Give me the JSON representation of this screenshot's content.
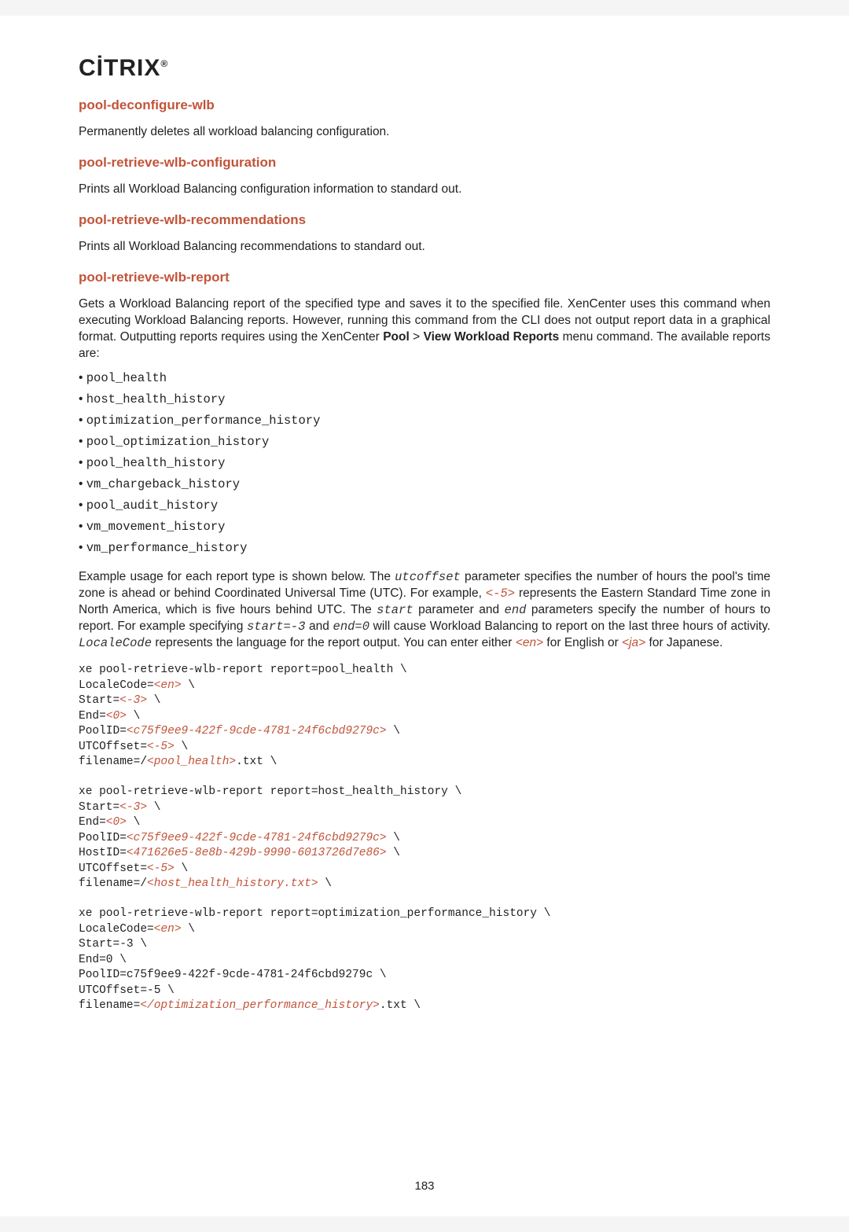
{
  "logo": "CİTRIX",
  "sections": {
    "s1": {
      "title": "pool-deconfigure-wlb",
      "text": "Permanently deletes all workload balancing configuration."
    },
    "s2": {
      "title": "pool-retrieve-wlb-configuration",
      "text": "Prints all Workload Balancing configuration information to standard out."
    },
    "s3": {
      "title": "pool-retrieve-wlb-recommendations",
      "text": "Prints all Workload Balancing recommendations to standard out."
    },
    "s4": {
      "title": "pool-retrieve-wlb-report"
    }
  },
  "s4_intro_1": "Gets a Workload Balancing report of the specified type and saves it to the specified file. XenCenter uses this command when executing Workload Balancing reports. However, running this command from the CLI does not output report data in a graphical format. Outputting reports requires using the XenCenter ",
  "s4_intro_pool": "Pool",
  "s4_intro_gt": " > ",
  "s4_intro_view": "View Workload Reports",
  "s4_intro_tail": " menu command. The available reports are:",
  "reports": [
    "pool_health",
    "host_health_history",
    "optimization_performance_history",
    "pool_optimization_history",
    "pool_health_history",
    "vm_chargeback_history",
    "pool_audit_history",
    "vm_movement_history",
    "vm_performance_history"
  ],
  "ex": {
    "p1": "Example usage for each report type is shown below. The ",
    "utcoffset": "utcoffset",
    "p2": " parameter specifies the number of hours the pool's time zone is ahead or behind Coordinated Universal Time (UTC). For example, ",
    "neg5": "<-5>",
    "p3": " represents the Eastern Standard Time zone in North America, which is five hours behind UTC. The ",
    "start": "start",
    "p4": " parameter and ",
    "end": "end",
    "p5": " parameters specify the number of hours to report. For example specifying ",
    "startex": "start=-3",
    "and": " and ",
    "endex": "end=0",
    "p6": " will cause Workload Balancing to report on the last three hours of activity. ",
    "locale": "LocaleCode",
    "p7": " represents the language for the report output. You can enter either ",
    "en": "<en>",
    "eng": " for English or ",
    "ja": "<ja>",
    "jap": " for Japanese."
  },
  "code": {
    "b1_l1": "xe pool-retrieve-wlb-report report=pool_health \\",
    "b1_l2a": "LocaleCode=",
    "b1_l2b": "<en>",
    "b1_l2c": " \\",
    "b1_l3a": "Start=",
    "b1_l3b": "<-3>",
    "b1_l3c": " \\",
    "b1_l4a": "End=",
    "b1_l4b": "<0>",
    "b1_l4c": " \\",
    "b1_l5a": "PoolID=",
    "b1_l5b": "<c75f9ee9-422f-9cde-4781-24f6cbd9279c>",
    "b1_l5c": " \\",
    "b1_l6a": "UTCOffset=",
    "b1_l6b": "<-5>",
    "b1_l6c": " \\",
    "b1_l7a": "filename=/",
    "b1_l7b": "<pool_health>",
    "b1_l7c": ".txt \\",
    "b2_l1": "xe pool-retrieve-wlb-report report=host_health_history \\",
    "b2_l2a": "Start=",
    "b2_l2b": "<-3>",
    "b2_l2c": " \\",
    "b2_l3a": "End=",
    "b2_l3b": "<0>",
    "b2_l3c": " \\",
    "b2_l4a": "PoolID=",
    "b2_l4b": "<c75f9ee9-422f-9cde-4781-24f6cbd9279c>",
    "b2_l4c": " \\",
    "b2_l5a": "HostID=",
    "b2_l5b": "<471626e5-8e8b-429b-9990-6013726d7e86>",
    "b2_l5c": " \\",
    "b2_l6a": "UTCOffset=",
    "b2_l6b": "<-5>",
    "b2_l6c": " \\",
    "b2_l7a": "filename=/",
    "b2_l7b": "<host_health_history.txt>",
    "b2_l7c": " \\",
    "b3_l1": "xe pool-retrieve-wlb-report report=optimization_performance_history \\",
    "b3_l2a": "LocaleCode=",
    "b3_l2b": "<en>",
    "b3_l2c": " \\",
    "b3_l3": "Start=-3 \\",
    "b3_l4": "End=0 \\",
    "b3_l5": "PoolID=c75f9ee9-422f-9cde-4781-24f6cbd9279c \\",
    "b3_l6": "UTCOffset=-5 \\",
    "b3_l7a": "filename=",
    "b3_l7b": "</optimization_performance_history>",
    "b3_l7c": ".txt \\"
  },
  "page_number": "183"
}
